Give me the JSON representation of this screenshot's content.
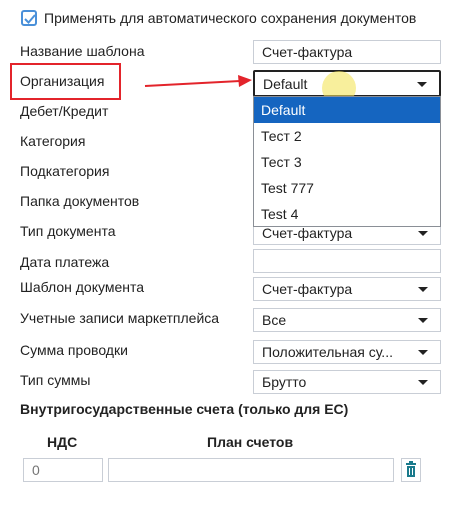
{
  "header": {
    "auto_save_checkbox_label": "Применять для автоматического сохранения документов",
    "auto_save_checked": true
  },
  "form": {
    "template_name": {
      "label": "Название шаблона",
      "value": "Счет-фактура"
    },
    "organization": {
      "label": "Организация",
      "value": "Default"
    },
    "debit_credit": {
      "label": "Дебет/Кредит"
    },
    "category": {
      "label": "Категория"
    },
    "subcategory": {
      "label": "Подкатегория"
    },
    "documents_folder": {
      "label": "Папка документов"
    },
    "document_type": {
      "label": "Тип документа",
      "value": "Счет-фактура"
    },
    "payment_date": {
      "label": "Дата платежа",
      "value": ""
    },
    "document_template": {
      "label": "Шаблон документа",
      "value": "Счет-фактура"
    },
    "marketplace_accounts": {
      "label": "Учетные записи маркетплейса",
      "value": "Все"
    },
    "posting_amount": {
      "label": "Сумма проводки",
      "value": "Положительная су..."
    },
    "amount_type": {
      "label": "Тип суммы",
      "value": "Брутто"
    }
  },
  "organization_dropdown": {
    "options": [
      "Default",
      "Тест 2",
      "Тест 3",
      "Test 777",
      "Test 4"
    ],
    "selected": "Default"
  },
  "intrastate": {
    "title": "Внутригосударственные счета (только для ЕС)",
    "col_vat": "НДС",
    "col_chart": "План счетов",
    "vat_placeholder": "0",
    "chart_value": ""
  },
  "colors": {
    "accent": "#1565c0",
    "annotation_red": "#e3242b",
    "checkbox_blue": "#4a90d9",
    "cursor_highlight": "#f3e45a",
    "trash_icon": "#1a7a8c"
  },
  "icons": [
    "checkmark-icon",
    "chevron-down-icon",
    "trash-icon",
    "red-arrow-annotation",
    "cursor-highlight"
  ]
}
